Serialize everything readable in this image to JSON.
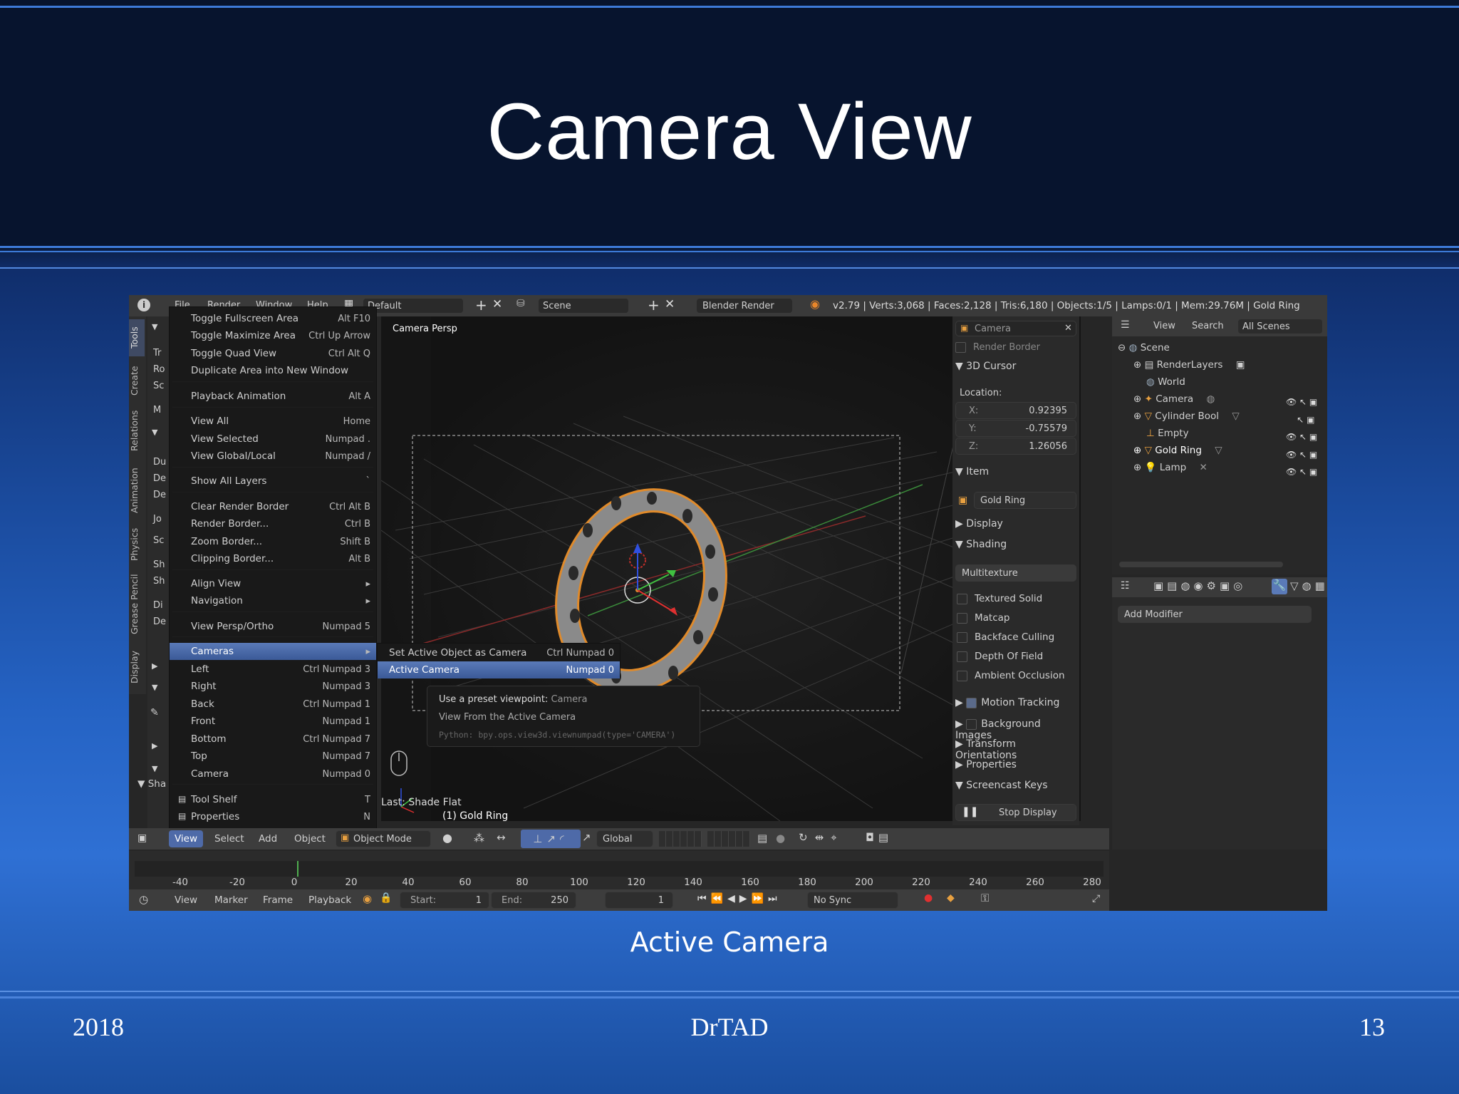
{
  "slide": {
    "title": "Camera View",
    "caption": "Active Camera",
    "footer_left": "2018",
    "footer_center": "DrTAD",
    "footer_right": "13"
  },
  "topbar": {
    "menus": [
      "File",
      "Render",
      "Window",
      "Help"
    ],
    "layout": "Default",
    "scene": "Scene",
    "engine": "Blender Render",
    "stats": "v2.79 | Verts:3,068 | Faces:2,128 | Tris:6,180 | Objects:1/5 | Lamps:0/1 | Mem:29.76M | Gold Ring"
  },
  "tool_tabs": [
    "Tools",
    "Create",
    "Relations",
    "Animation",
    "Physics",
    "Grease Pencil",
    "Display"
  ],
  "toolshelf_partial": [
    "Tr",
    "Ro",
    "Sc",
    "M",
    "Du",
    "De",
    "Jo",
    "Sc",
    "Sh",
    "Sh",
    "Di",
    "De"
  ],
  "view_menu": [
    {
      "label": "Toggle Fullscreen Area",
      "shortcut": "Alt F10"
    },
    {
      "label": "Toggle Maximize Area",
      "shortcut": "Ctrl Up Arrow"
    },
    {
      "label": "Toggle Quad View",
      "shortcut": "Ctrl Alt Q"
    },
    {
      "label": "Duplicate Area into New Window",
      "shortcut": ""
    },
    {
      "label": "Playback Animation",
      "shortcut": "Alt A"
    },
    {
      "label": "View All",
      "shortcut": "Home"
    },
    {
      "label": "View Selected",
      "shortcut": "Numpad ."
    },
    {
      "label": "View Global/Local",
      "shortcut": "Numpad /"
    },
    {
      "label": "Show All Layers",
      "shortcut": "`"
    },
    {
      "label": "Clear Render Border",
      "shortcut": "Ctrl Alt B"
    },
    {
      "label": "Render Border...",
      "shortcut": "Ctrl B"
    },
    {
      "label": "Zoom Border...",
      "shortcut": "Shift B"
    },
    {
      "label": "Clipping Border...",
      "shortcut": "Alt B"
    },
    {
      "label": "Align View",
      "shortcut": "▸"
    },
    {
      "label": "Navigation",
      "shortcut": "▸"
    },
    {
      "label": "View Persp/Ortho",
      "shortcut": "Numpad 5"
    },
    {
      "label": "Cameras",
      "shortcut": "▸"
    },
    {
      "label": "Left",
      "shortcut": "Ctrl Numpad 3"
    },
    {
      "label": "Right",
      "shortcut": "Numpad 3"
    },
    {
      "label": "Back",
      "shortcut": "Ctrl Numpad 1"
    },
    {
      "label": "Front",
      "shortcut": "Numpad 1"
    },
    {
      "label": "Bottom",
      "shortcut": "Ctrl Numpad 7"
    },
    {
      "label": "Top",
      "shortcut": "Numpad 7"
    },
    {
      "label": "Camera",
      "shortcut": "Numpad 0"
    },
    {
      "label": "Tool Shelf",
      "shortcut": "T"
    },
    {
      "label": "Properties",
      "shortcut": "N"
    }
  ],
  "cameras_submenu": [
    {
      "label": "Set Active Object as Camera",
      "shortcut": "Ctrl Numpad 0"
    },
    {
      "label": "Active Camera",
      "shortcut": "Numpad 0"
    }
  ],
  "tooltip": {
    "line1_prefix": "Use a preset viewpoint:",
    "line1_value": "Camera",
    "line2": "View From the Active Camera",
    "python": "Python: bpy.ops.view3d.viewnumpad(type='CAMERA')"
  },
  "viewport": {
    "label": "Camera Persp",
    "last_op": "Last: Shade Flat",
    "object_label": "(1) Gold Ring",
    "toolshelf_bottom": "Sha"
  },
  "npanel": {
    "camera_field": "Camera",
    "render_border": "Render Border",
    "cursor_header": "3D Cursor",
    "location_label": "Location:",
    "loc": [
      {
        "axis": "X:",
        "value": "0.92395"
      },
      {
        "axis": "Y:",
        "value": "-0.75579"
      },
      {
        "axis": "Z:",
        "value": "1.26056"
      }
    ],
    "item_header": "Item",
    "item_name": "Gold Ring",
    "display_header": "Display",
    "shading_header": "Shading",
    "shading_mode": "Multitexture",
    "shading_options": [
      "Textured Solid",
      "Matcap",
      "Backface Culling",
      "Depth Of Field",
      "Ambient Occlusion"
    ],
    "motion_tracking": "Motion Tracking",
    "background_images": "Background Images",
    "transform_orientations": "Transform Orientations",
    "properties": "Properties",
    "screencast": "Screencast Keys",
    "stop_display": "Stop Display"
  },
  "outliner": {
    "menus": [
      "View",
      "Search"
    ],
    "filter": "All Scenes",
    "items": [
      "Scene",
      "RenderLayers",
      "World",
      "Camera",
      "Cylinder Bool",
      "Empty",
      "Gold Ring",
      "Lamp"
    ]
  },
  "properties_editor": {
    "add_modifier": "Add Modifier"
  },
  "view3d_header": {
    "menus": [
      "View",
      "Select",
      "Add",
      "Object"
    ],
    "mode": "Object Mode",
    "orientation": "Global"
  },
  "timeline": {
    "ticks": [
      "-40",
      "-20",
      "0",
      "20",
      "40",
      "60",
      "80",
      "100",
      "120",
      "140",
      "160",
      "180",
      "200",
      "220",
      "240",
      "260",
      "280"
    ],
    "menus": [
      "View",
      "Marker",
      "Frame",
      "Playback"
    ],
    "start_label": "Start:",
    "start": "1",
    "end_label": "End:",
    "end": "250",
    "current": "1",
    "sync": "No Sync"
  }
}
